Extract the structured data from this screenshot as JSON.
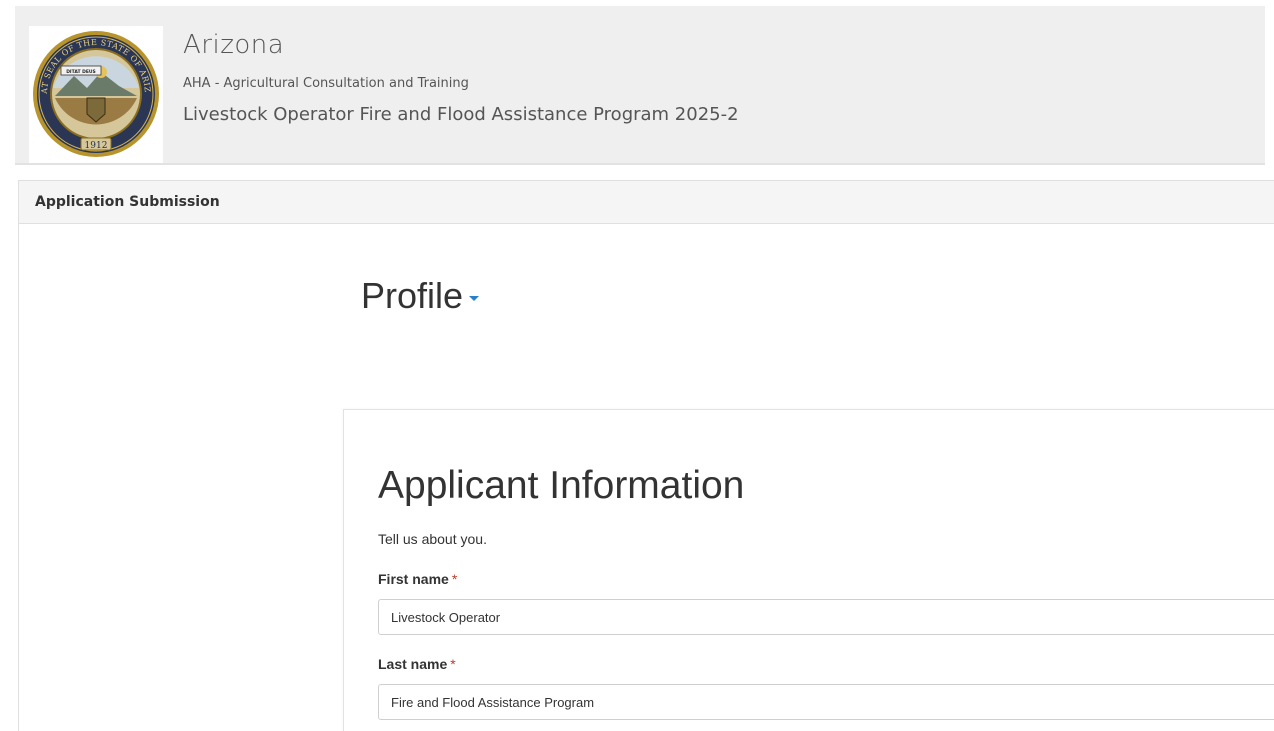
{
  "header": {
    "seal_label": "Great Seal of the State of Arizona",
    "seal_text_top": "GREAT SEAL OF THE STATE OF ARIZONA",
    "seal_motto": "DITAT DEUS",
    "seal_year": "1912",
    "state": "Arizona",
    "agency": "AHA - Agricultural Consultation and Training",
    "program": "Livestock Operator Fire and Flood Assistance Program 2025-2"
  },
  "panel": {
    "heading": "Application Submission"
  },
  "profile": {
    "title": "Profile"
  },
  "form": {
    "section_title": "Applicant Information",
    "section_description": "Tell us about you.",
    "required_marker": "*",
    "first_name": {
      "label": "First name",
      "value": "Livestock Operator"
    },
    "last_name": {
      "label": "Last name",
      "value": "Fire and Flood Assistance Program"
    }
  },
  "colors": {
    "header_bg": "#efefef",
    "accent": "#2a7fc9",
    "required": "#c0392b",
    "seal_gold": "#b8942c",
    "seal_navy": "#1f2d4e"
  }
}
